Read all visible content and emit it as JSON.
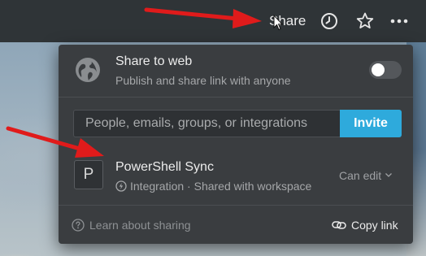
{
  "topbar": {
    "share_label": "Share",
    "icons": [
      "history-icon",
      "star-icon",
      "more-icon"
    ]
  },
  "share_to_web": {
    "title": "Share to web",
    "subtitle": "Publish and share link with anyone",
    "toggle_on": false
  },
  "invite": {
    "placeholder": "People, emails, groups, or integrations",
    "button_label": "Invite"
  },
  "member": {
    "avatar_letter": "P",
    "name": "PowerShell Sync",
    "subtitle": "Integration · Shared with workspace",
    "permission": "Can edit"
  },
  "footer": {
    "learn_label": "Learn about sharing",
    "copy_label": "Copy link"
  },
  "colors": {
    "accent": "#2eaadc",
    "annotation_arrow": "#e01b1b",
    "popup_bg": "#3a3d40",
    "topbar_bg": "#2f3437"
  }
}
